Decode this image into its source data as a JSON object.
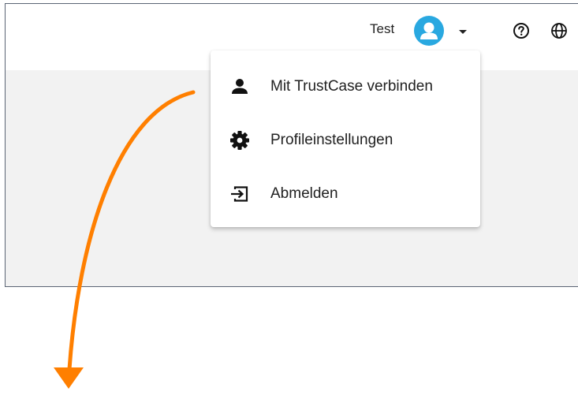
{
  "header": {
    "user_name": "Test",
    "accent_color": "#29a8e0",
    "icons": [
      "user-avatar",
      "chevron-down-icon",
      "help-circle-icon",
      "globe-icon"
    ]
  },
  "user_menu": {
    "items": [
      {
        "label": "Mit TrustCase verbinden",
        "icon": "person-icon"
      },
      {
        "label": "Profileinstellungen",
        "icon": "gear-icon"
      },
      {
        "label": "Abmelden",
        "icon": "logout-icon"
      }
    ]
  },
  "annotation": {
    "arrow_color": "#ff7f00"
  }
}
